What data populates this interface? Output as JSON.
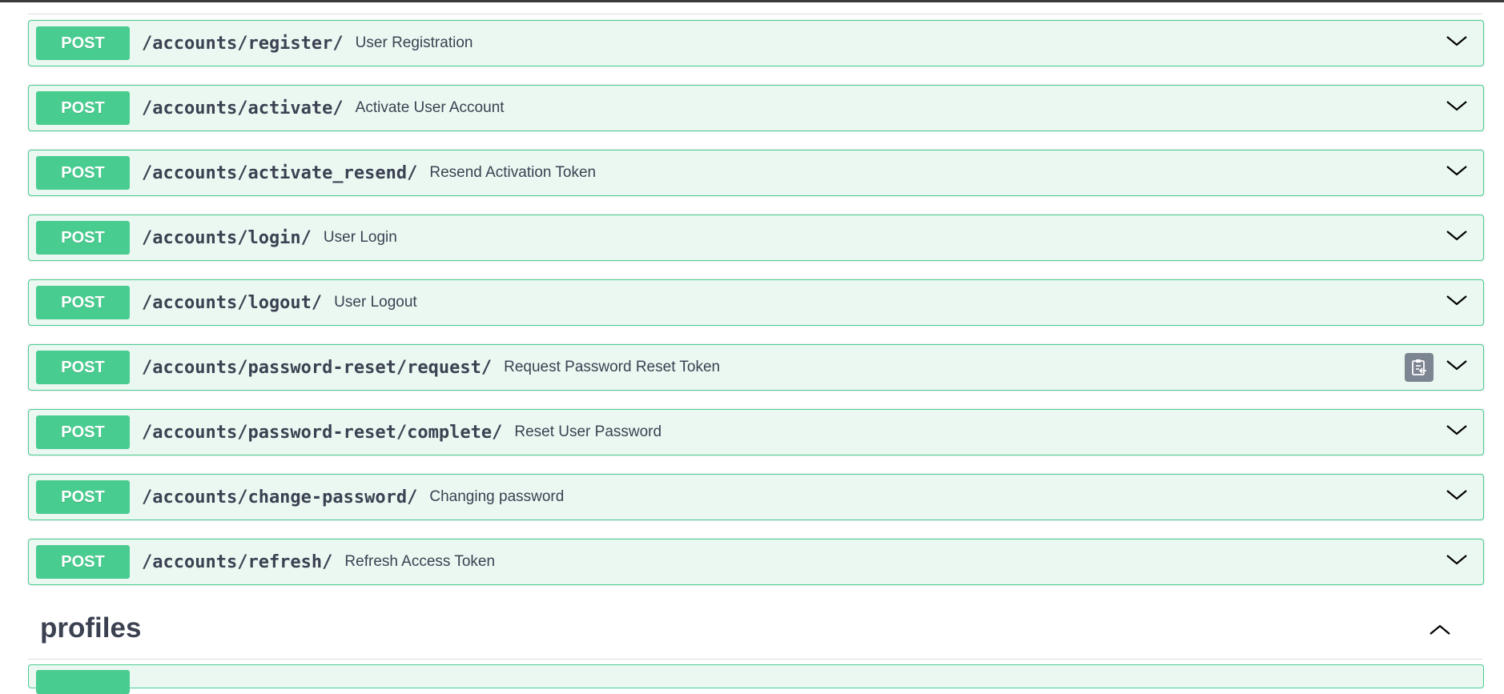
{
  "operations": [
    {
      "method": "POST",
      "path": "/accounts/register/",
      "summary": "User Registration"
    },
    {
      "method": "POST",
      "path": "/accounts/activate/",
      "summary": "Activate User Account"
    },
    {
      "method": "POST",
      "path": "/accounts/activate_resend/",
      "summary": "Resend Activation Token"
    },
    {
      "method": "POST",
      "path": "/accounts/login/",
      "summary": "User Login"
    },
    {
      "method": "POST",
      "path": "/accounts/logout/",
      "summary": "User Logout"
    },
    {
      "method": "POST",
      "path": "/accounts/password-reset/request/",
      "summary": "Request Password Reset Token"
    },
    {
      "method": "POST",
      "path": "/accounts/password-reset/complete/",
      "summary": "Reset User Password"
    },
    {
      "method": "POST",
      "path": "/accounts/change-password/",
      "summary": "Changing password"
    },
    {
      "method": "POST",
      "path": "/accounts/refresh/",
      "summary": "Refresh Access Token"
    }
  ],
  "section": {
    "title": "profiles",
    "expanded": true
  },
  "colors": {
    "post_accent": "#49cc90",
    "post_background": "#ebf8f2",
    "text": "#3b4151",
    "copy_button": "#7d8492"
  },
  "icons": {
    "expand": "chevron-down-icon",
    "collapse": "chevron-up-icon",
    "copy": "clipboard-icon"
  }
}
